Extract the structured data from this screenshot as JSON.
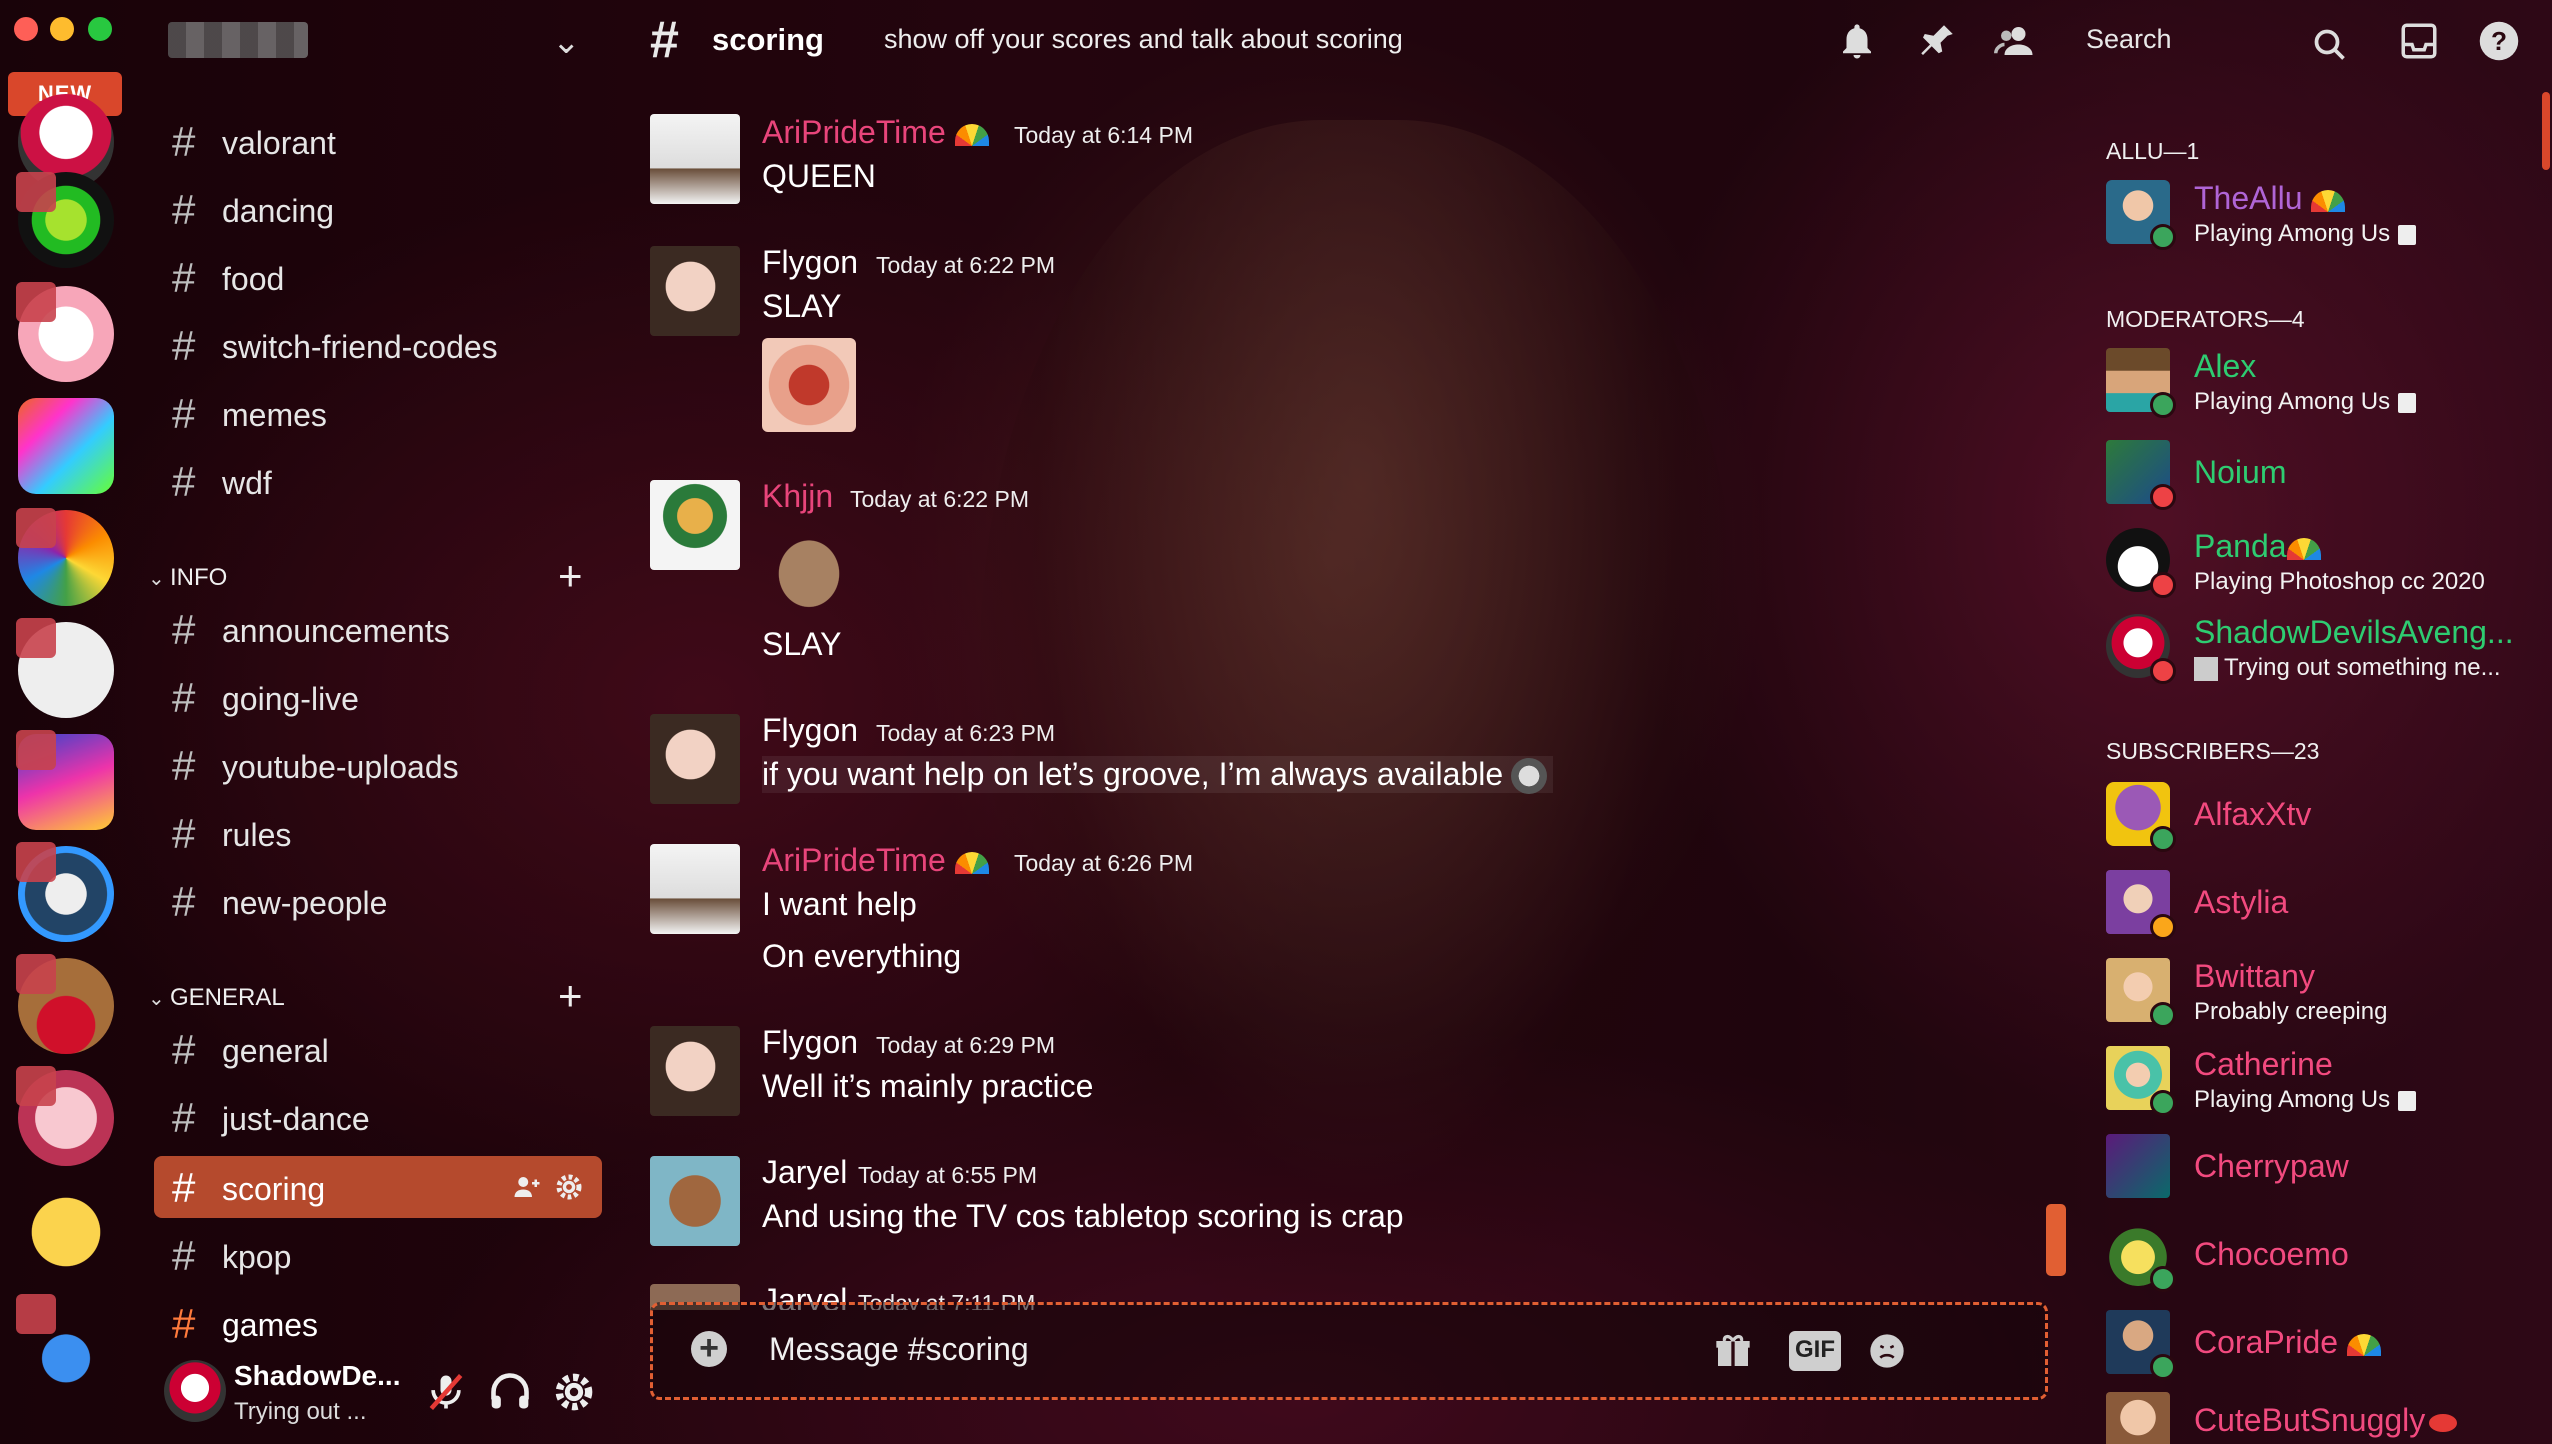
{
  "window": {
    "traffic_lights": [
      "close",
      "minimize",
      "zoom"
    ]
  },
  "header": {
    "channel_name": "scoring",
    "channel_topic": "show off your scores and talk about scoring",
    "search_placeholder": "Search",
    "icons": [
      "bell-icon",
      "pin-icon",
      "members-icon",
      "search-icon",
      "inbox-icon",
      "help-icon"
    ]
  },
  "servers": {
    "new_badge": "NEW"
  },
  "sidebar": {
    "channels_top": [
      {
        "label": "valorant"
      },
      {
        "label": "dancing"
      },
      {
        "label": "food"
      },
      {
        "label": "switch-friend-codes"
      },
      {
        "label": "memes"
      },
      {
        "label": "wdf"
      }
    ],
    "categories": [
      {
        "label": "INFO",
        "channels": [
          {
            "label": "announcements"
          },
          {
            "label": "going-live"
          },
          {
            "label": "youtube-uploads"
          },
          {
            "label": "rules"
          },
          {
            "label": "new-people"
          }
        ]
      },
      {
        "label": "GENERAL",
        "channels": [
          {
            "label": "general"
          },
          {
            "label": "just-dance"
          },
          {
            "label": "scoring"
          },
          {
            "label": "kpop"
          },
          {
            "label": "games"
          }
        ]
      }
    ]
  },
  "user_panel": {
    "name": "ShadowDe...",
    "status": "Trying out ..."
  },
  "messages": [
    {
      "author": "AriPrideTime",
      "time": "Today at 6:14 PM",
      "lines": [
        "QUEEN"
      ]
    },
    {
      "author": "Flygon",
      "time": "Today at 6:22 PM",
      "lines": [
        "SLAY"
      ]
    },
    {
      "author": "Khjjn",
      "time": "Today at 6:22 PM",
      "lines": [
        "SLAY"
      ]
    },
    {
      "author": "Flygon",
      "time": "Today at 6:23 PM",
      "lines": [
        "if you want help on let’s groove, I’m always available"
      ]
    },
    {
      "author": "AriPrideTime",
      "time": "Today at 6:26 PM",
      "lines": [
        "I want help",
        "On everything"
      ]
    },
    {
      "author": "Flygon",
      "time": "Today at 6:29 PM",
      "lines": [
        "Well it’s mainly practice"
      ]
    },
    {
      "author": "Jaryel",
      "time": "Today at 6:55 PM",
      "lines": [
        "And using the TV cos tabletop scoring is crap"
      ]
    },
    {
      "author": "Jaryel",
      "time": "Today at 7:11 PM",
      "lines": []
    }
  ],
  "composer": {
    "placeholder": "Message #scoring",
    "gif_label": "GIF"
  },
  "members": {
    "groups": [
      {
        "label": "ALLU—1"
      },
      {
        "label": "MODERATORS—4"
      },
      {
        "label": "SUBSCRIBERS—23"
      }
    ],
    "list": [
      {
        "name": "TheAllu",
        "activity": "Playing Among Us"
      },
      {
        "name": "Alex",
        "activity": "Playing Among Us"
      },
      {
        "name": "Noium",
        "activity": ""
      },
      {
        "name": "Panda",
        "activity": "Playing Photoshop cc 2020"
      },
      {
        "name": "ShadowDevilsAveng...",
        "activity": "Trying out something ne..."
      },
      {
        "name": "AlfaxXtv",
        "activity": ""
      },
      {
        "name": "Astylia",
        "activity": ""
      },
      {
        "name": "Bwittany",
        "activity": "Probably creeping"
      },
      {
        "name": "Catherine",
        "activity": "Playing Among Us"
      },
      {
        "name": "Cherrypaw",
        "activity": ""
      },
      {
        "name": "Chocoemo",
        "activity": ""
      },
      {
        "name": "CoraPride",
        "activity": ""
      },
      {
        "name": "CuteButSnuggly",
        "activity": ""
      }
    ]
  },
  "colors": {
    "accent": "#e15f33",
    "active_channel": "#b54a2d",
    "author_pink": "#e8457b",
    "moderator_green": "#2ecc71",
    "allu_purple": "#b065d6",
    "subscriber_pink": "#f24a7f"
  }
}
